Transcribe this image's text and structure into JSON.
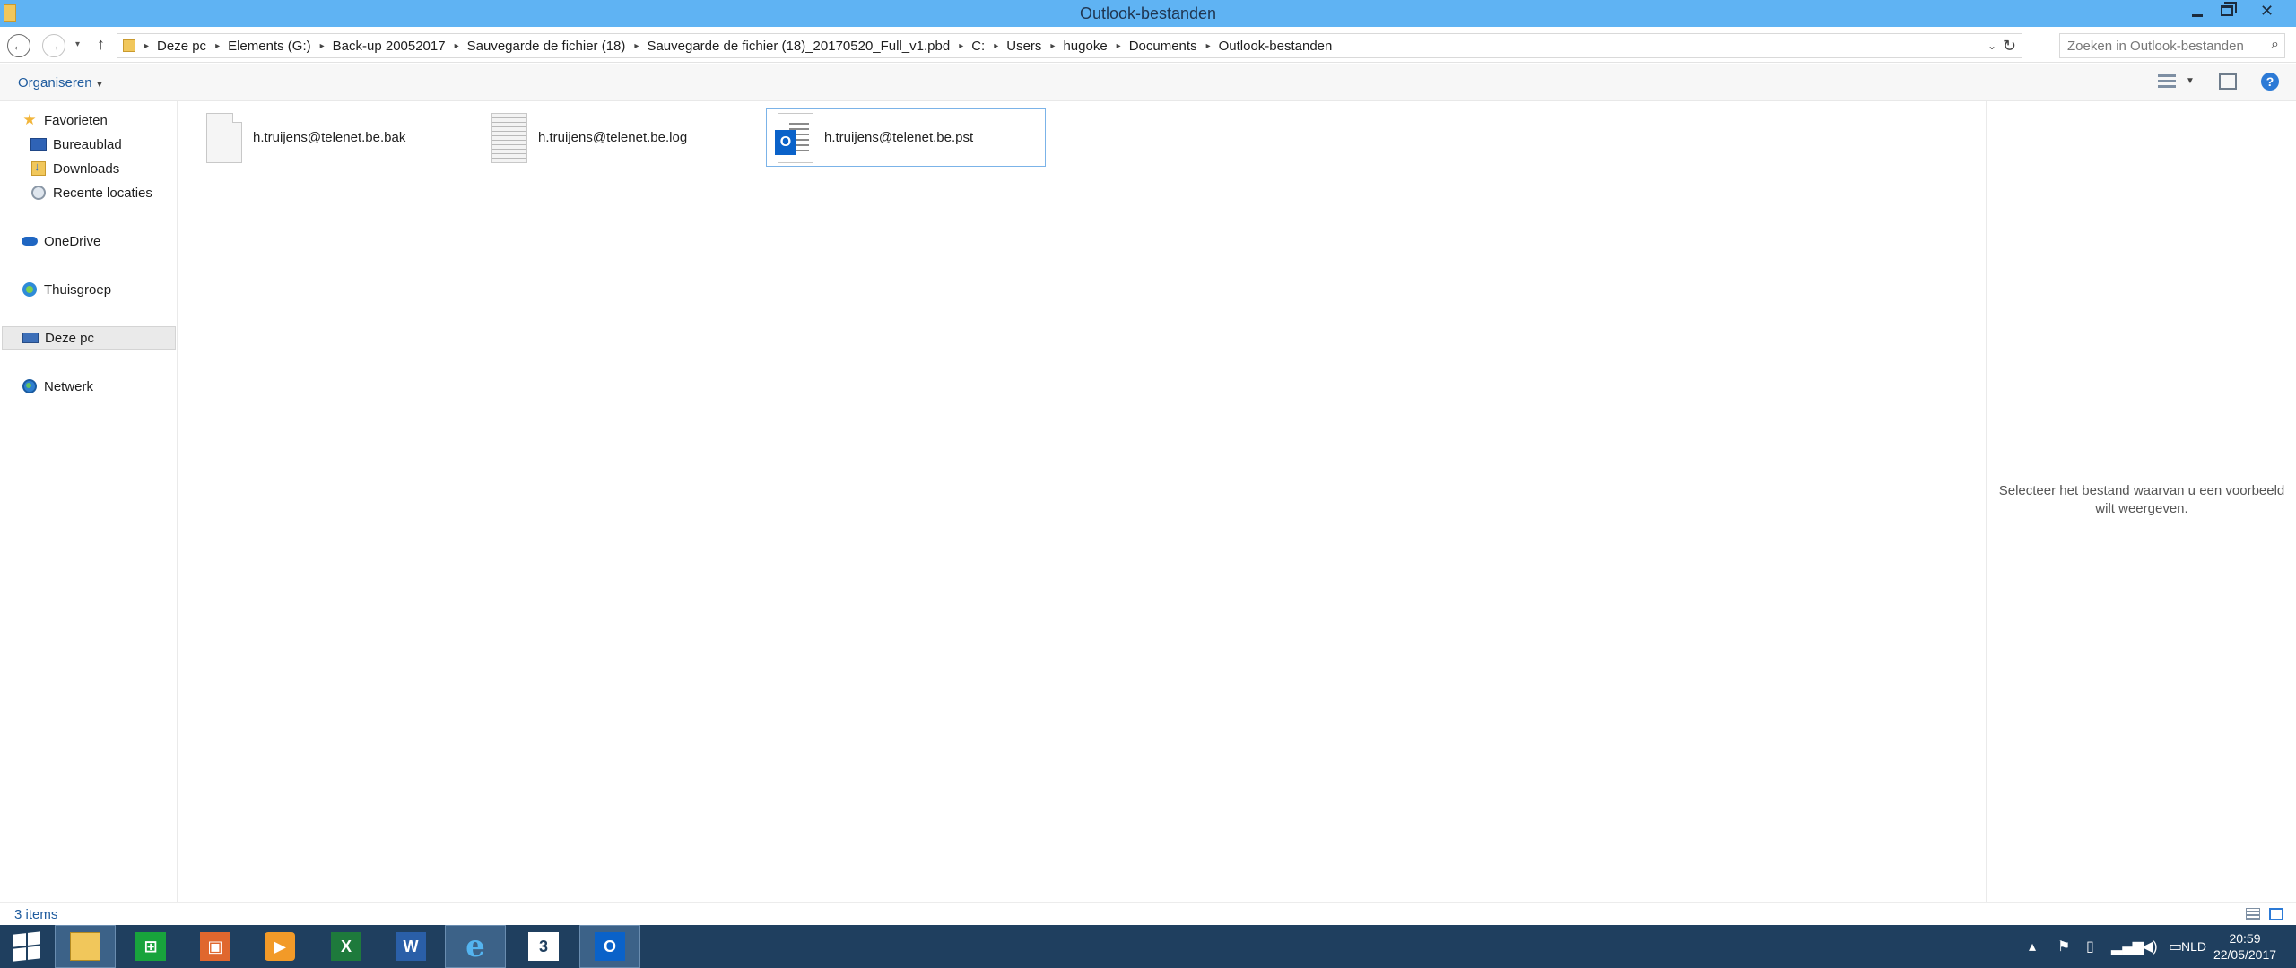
{
  "window": {
    "title": "Outlook-bestanden"
  },
  "address_bar": {
    "breadcrumbs": [
      "Deze pc",
      "Elements (G:)",
      "Back-up 20052017",
      "Sauvegarde de fichier (18)",
      "Sauvegarde de fichier (18)_20170520_Full_v1.pbd",
      "C:",
      "Users",
      "hugoke",
      "Documents",
      "Outlook-bestanden"
    ]
  },
  "search": {
    "placeholder": "Zoeken in Outlook-bestanden"
  },
  "toolbar": {
    "organize_label": "Organiseren"
  },
  "nav_pane": {
    "favorites": "Favorieten",
    "desktop": "Bureaublad",
    "downloads": "Downloads",
    "recent": "Recente locaties",
    "onedrive": "OneDrive",
    "homegroup": "Thuisgroep",
    "this_pc": "Deze pc",
    "network": "Netwerk"
  },
  "files": [
    {
      "name": "h.truijens@telenet.be.bak",
      "icon": "generic-file-icon"
    },
    {
      "name": "h.truijens@telenet.be.log",
      "icon": "text-file-icon"
    },
    {
      "name": "h.truijens@telenet.be.pst",
      "icon": "outlook-data-file-icon",
      "selected": true
    }
  ],
  "preview": {
    "message_line1": "Selecteer het bestand waarvan u een voorbeeld",
    "message_line2": "wilt weergeven."
  },
  "status": {
    "item_count": "3 items"
  },
  "taskbar": {
    "calendar_day": "3",
    "language": "NLD",
    "time": "20:59",
    "date": "22/05/2017"
  },
  "colors": {
    "titlebar": "#5fb3f3",
    "taskbar": "#1f3f5f",
    "selection_border": "#7bb3e8",
    "accent_link": "#1e5b9e"
  }
}
